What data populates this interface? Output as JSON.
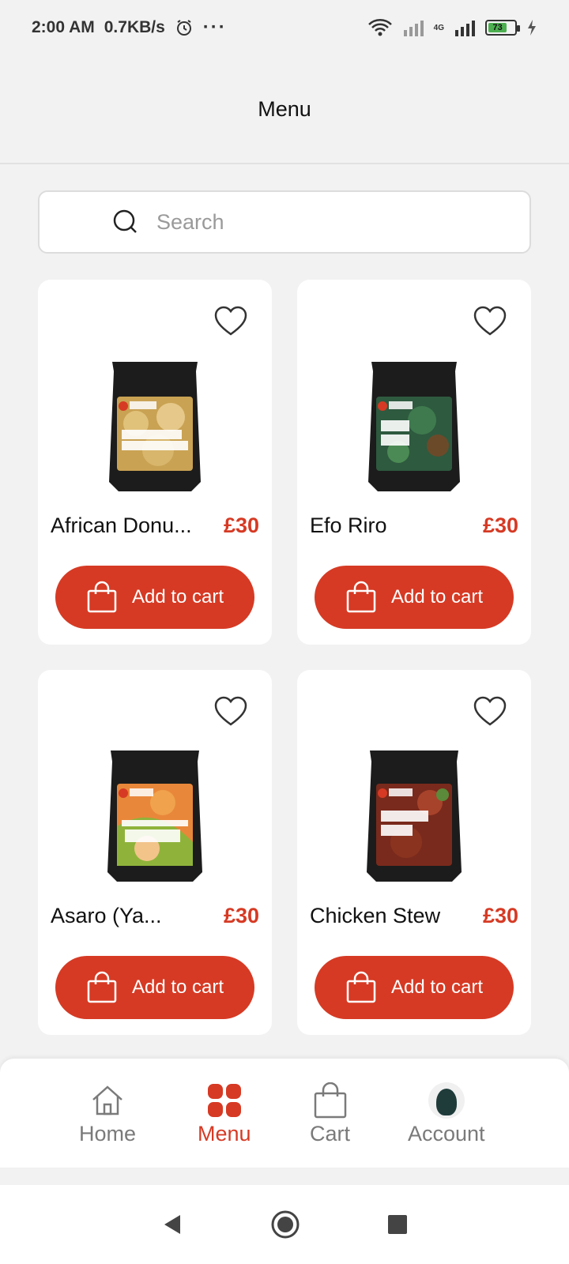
{
  "status": {
    "time": "2:00 AM",
    "speed": "0.7KB/s",
    "more": "···",
    "battery": "73",
    "network_label": "4G"
  },
  "header": {
    "title": "Menu"
  },
  "search": {
    "placeholder": "Search"
  },
  "products": [
    {
      "name": "African Donu...",
      "price": "£30",
      "button": "Add to cart",
      "image": "african-donut-mix-bag"
    },
    {
      "name": "Efo Riro",
      "price": "£30",
      "button": "Add to cart",
      "image": "efo-riro-bag"
    },
    {
      "name": "Asaro (Ya...",
      "price": "£30",
      "button": "Add to cart",
      "image": "asaro-yam-porridge-bag"
    },
    {
      "name": "Chicken Stew",
      "price": "£30",
      "button": "Add to cart",
      "image": "chicken-stew-bag"
    }
  ],
  "nav": {
    "home": "Home",
    "menu": "Menu",
    "cart": "Cart",
    "account": "Account"
  },
  "colors": {
    "accent": "#d63a24",
    "background": "#f2f2f2"
  }
}
